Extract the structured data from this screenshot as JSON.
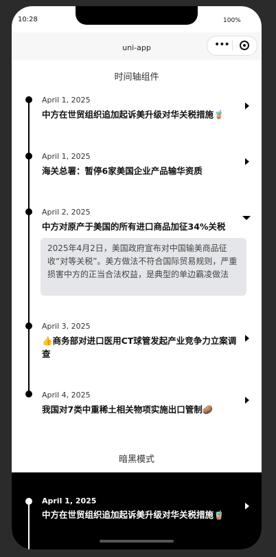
{
  "status": {
    "time": "10:28",
    "battery": "100%"
  },
  "nav": {
    "title": "uni-app",
    "more_glyph": "•••"
  },
  "timeline": {
    "section_title": "时间轴组件",
    "items": [
      {
        "date": "April 1, 2025",
        "title": "中方在世贸组织追加起诉美升级对华关税措施🧋",
        "expanded": false
      },
      {
        "date": "April 1, 2025",
        "title": "海关总署：暂停6家美国企业产品输华资质",
        "expanded": false
      },
      {
        "date": "April 2, 2025",
        "title": "中方对原产于美国的所有进口商品加征34%关税",
        "expanded": true,
        "detail": "2025年4月2日，美国政府宣布对中国输美商品征收“对等关税”。美方做法不符合国际贸易规则，严重损害中方的正当合法权益，是典型的单边霸凌做法"
      },
      {
        "date": "April 3, 2025",
        "title": "👍商务部对进口医用CT球管发起产业竞争力立案调查",
        "expanded": false
      },
      {
        "date": "April 4, 2025",
        "title": "我国对7类中重稀土相关物项实施出口管制🥔",
        "expanded": false
      }
    ]
  },
  "dark_mode": {
    "section_title": "暗黑模式",
    "items": [
      {
        "date": "April 1, 2025",
        "title": "中方在世贸组织追加起诉美升级对华关税措施🧋"
      }
    ]
  },
  "colors": {
    "page_bg": "#ffffff",
    "detail_bg": "#e5e6ea",
    "dark_bg": "#000000",
    "frame": "#2b2b2b"
  }
}
